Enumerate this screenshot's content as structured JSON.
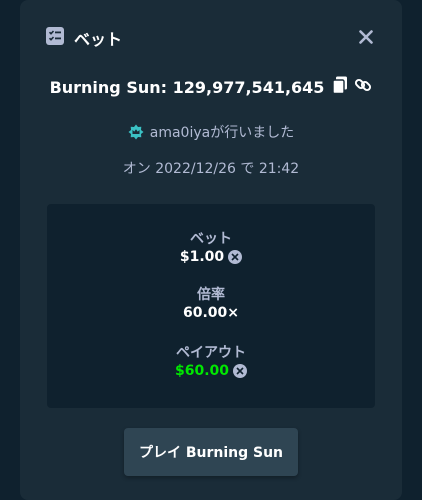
{
  "modal": {
    "title": "ベット",
    "icon": "checklist-icon",
    "close_icon": "close-icon"
  },
  "bet": {
    "game_and_id": "Burning Sun: 129,977,541,645",
    "copy_icon": "copy-icon",
    "link_icon": "link-icon"
  },
  "user": {
    "badge_icon": "vip-crown-badge-icon",
    "text": "ama0iyaが行いました"
  },
  "date_text": "オン 2022/12/26 で 21:42",
  "stats": {
    "bet_label": "ベット",
    "bet_value": "$1.00",
    "multiplier_label": "倍率",
    "multiplier_value": "60.00×",
    "payout_label": "ペイアウト",
    "payout_value": "$60.00",
    "currency_icon": "currency-coin-icon"
  },
  "play_button_label": "プレイ Burning Sun",
  "colors": {
    "background": "#0f212e",
    "modal": "#1a2c38",
    "panel": "#0f212e",
    "muted_text": "#b1bad3",
    "payout_green": "#00e701",
    "button": "#2f4553",
    "badge_accent": "#3bc1c4"
  }
}
